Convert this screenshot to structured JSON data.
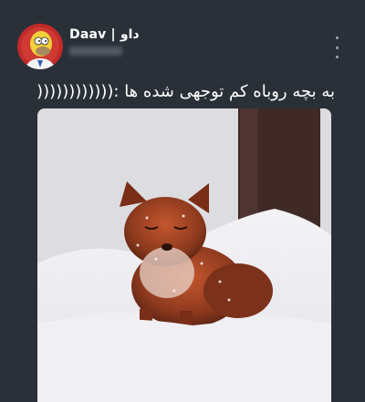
{
  "tweet": {
    "author_name": "Daav | داو",
    "text": "به بچه روباه کم توجهی شده ها :((((((((((((",
    "avatar_icon": "homer-simpson-avatar-icon",
    "more_icon": "more-options-icon",
    "media_icon": "fox-cub-in-snow-photo"
  },
  "colors": {
    "background": "#2a3038",
    "text": "#ffffff",
    "avatar_bg": "#c02a2a"
  }
}
